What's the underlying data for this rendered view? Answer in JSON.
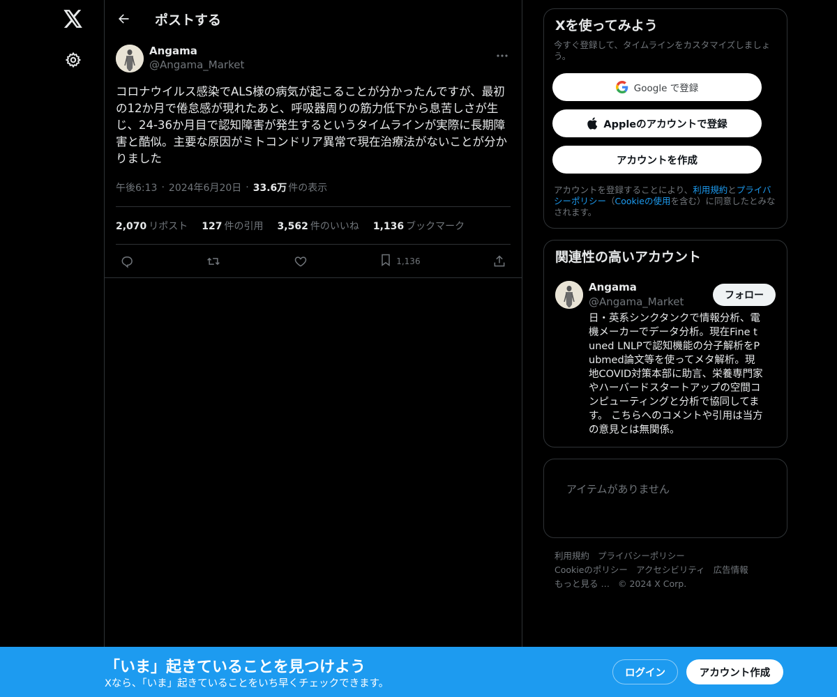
{
  "header": {
    "title": "ポストする"
  },
  "post": {
    "author_name": "Angama",
    "author_handle": "@Angama_Market",
    "text": "コロナウイルス感染でALS様の病気が起こることが分かったんですが、最初の12か月で倦怠感が現れたあと、呼吸器周りの筋力低下から息苦しさが生じ、24-36か月目で認知障害が発生するというタイムラインが実際に長期障害と酷似。主要な原因がミトコンドリア異常で現在治療法がないことが分かりました",
    "time": "午後6:13",
    "date": "2024年6月20日",
    "views": "33.6万",
    "views_label": "件の表示",
    "stats": {
      "reposts": "2,070",
      "reposts_label": "リポスト",
      "quotes": "127",
      "quotes_label": "件の引用",
      "likes": "3,562",
      "likes_label": "件のいいね",
      "bookmarks": "1,136",
      "bookmarks_label": "ブックマーク"
    },
    "bookmark_count": "1,136"
  },
  "signup": {
    "title": "Xを使ってみよう",
    "subtitle": "今すぐ登録して、タイムラインをカスタマイズしましょう。",
    "google_label": "Google で登録",
    "apple_label": "Appleのアカウントで登録",
    "create_label": "アカウントを作成",
    "terms_prefix": "アカウントを登録することにより、",
    "terms_link": "利用規約",
    "terms_and": "と",
    "privacy_link": "プライバシーポリシー",
    "terms_paren_open": "（",
    "cookie_link": "Cookieの使用",
    "terms_suffix": "を含む）に同意したとみなされます。"
  },
  "related": {
    "title": "関連性の高いアカウント",
    "name": "Angama",
    "handle": "@Angama_Market",
    "follow_label": "フォロー",
    "bio": "日・英系シンクタンクで情報分析、電機メーカーでデータ分析。現在Fine tuned LNLPで認知機能の分子解析をPubmed論文等を使ってメタ解析。現地COVID対策本部に助言、栄養専門家やハーバードスタートアップの空間コンピューティングと分析で協同してます。 こちらへのコメントや引用は当方の意見とは無関係。"
  },
  "trends": {
    "empty_text": "アイテムがありません"
  },
  "footer": {
    "terms": "利用規約",
    "privacy": "プライバシーポリシー",
    "cookie": "Cookieのポリシー",
    "accessibility": "アクセシビリティ",
    "ads": "広告情報",
    "more": "もっと見る …",
    "copyright": "© 2024 X Corp."
  },
  "banner": {
    "title": "「いま」起きていることを見つけよう",
    "subtitle": "Xなら、「いま」起きていることをいち早くチェックできます。",
    "login_label": "ログイン",
    "join_label": "アカウント作成"
  },
  "colors": {
    "accent": "#1d9bf0",
    "background": "#000000",
    "border": "#2f3336",
    "muted": "#71767b"
  }
}
